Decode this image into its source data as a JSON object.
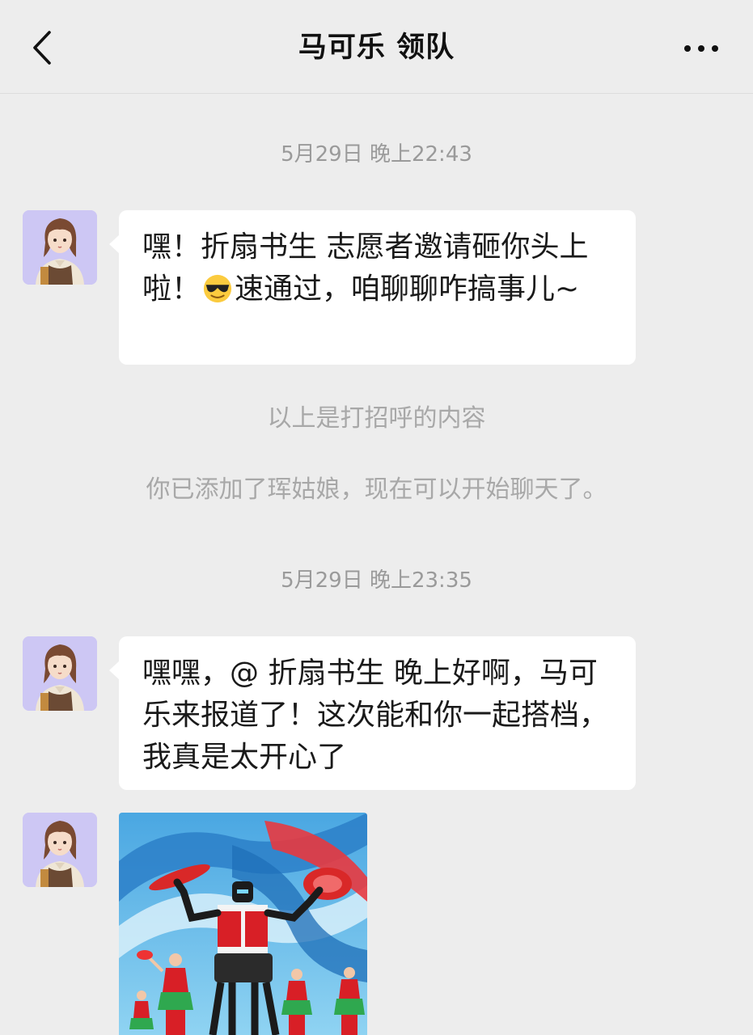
{
  "header": {
    "title": "马可乐 领队",
    "back_icon": "chevron-left-icon",
    "more_icon": "more-horizontal-icon"
  },
  "messages": {
    "timestamp_1": "5月29日 晚上22:43",
    "bubble_1": {
      "text_before_emoji": "嘿！折扇书生 志愿者邀请砸你头上啦！",
      "emoji": "cool-face-sunglasses-icon",
      "text_after_emoji": "速通过，咱聊聊咋搞事儿~"
    },
    "system_note_1": "以上是打招呼的内容",
    "system_note_2": "你已添加了珲姑娘，现在可以开始聊天了。",
    "timestamp_2": "5月29日 晚上23:35",
    "bubble_2": "嘿嘿，@ 折扇书生 晚上好啊，马可乐来报道了！这次能和你一起搭档，我真是太开心了",
    "image_message": "robot-performance-photo"
  },
  "colors": {
    "background": "#ededed",
    "bubble": "#ffffff",
    "avatar_bg": "#cdc7f4",
    "timestamp_text": "#9a9a9a"
  }
}
